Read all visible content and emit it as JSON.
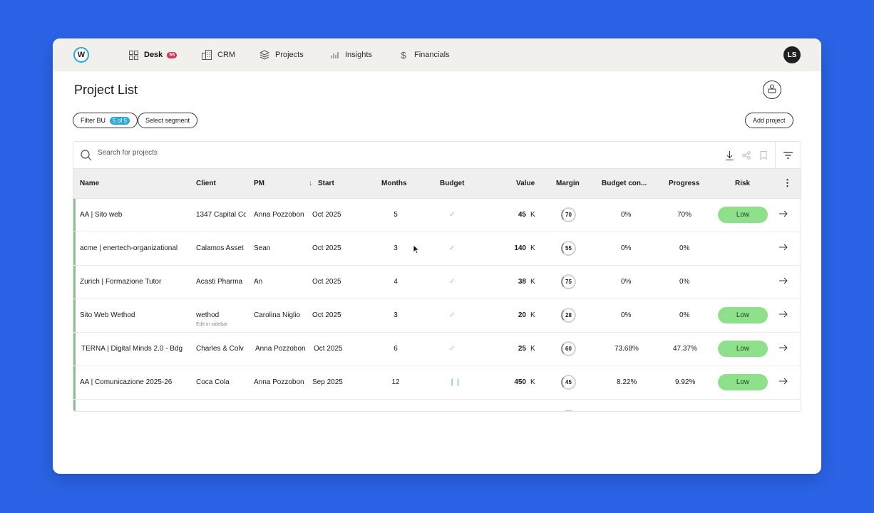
{
  "nav": {
    "logo": "W",
    "items": [
      {
        "label": "Desk",
        "badge": "55",
        "icon": "grid-icon"
      },
      {
        "label": "CRM",
        "icon": "building-icon"
      },
      {
        "label": "Projects",
        "icon": "layers-icon"
      },
      {
        "label": "Insights",
        "icon": "bar-chart-icon"
      },
      {
        "label": "Financials",
        "icon": "dollar-icon"
      }
    ],
    "avatar": "LS"
  },
  "page": {
    "title": "Project List",
    "filter_bu": "Filter BU",
    "filter_count": "5 of 5",
    "select_segment": "Select segment",
    "add_project": "Add project"
  },
  "search": {
    "placeholder": "Search for projects"
  },
  "columns": [
    "Name",
    "Client",
    "PM",
    "Start",
    "Months",
    "Budget",
    "Value",
    "Margin",
    "Budget con...",
    "Progress",
    "Risk"
  ],
  "rows": [
    {
      "name": "AA | Sito web",
      "client": "1347 Capital Co",
      "pm": "Anna Pozzobon",
      "start": "Oct 2025",
      "months": "5",
      "budget": "check",
      "value": "45",
      "unit": "K",
      "margin": "70",
      "budget_con": "0%",
      "progress": "70%",
      "risk": "Low"
    },
    {
      "name": "acme | enertech-organizational",
      "client": "Calamos Asset",
      "pm": "Sean",
      "start": "Oct 2025",
      "months": "3",
      "budget": "check",
      "value": "140",
      "unit": "K",
      "margin": "55",
      "budget_con": "0%",
      "progress": "0%",
      "risk": ""
    },
    {
      "name": "Zurich | Formazione Tutor",
      "client": "Acasti Pharma",
      "pm": "An",
      "start": "Oct 2025",
      "months": "4",
      "budget": "check",
      "value": "38",
      "unit": "K",
      "margin": "75",
      "budget_con": "0%",
      "progress": "0%",
      "risk": ""
    },
    {
      "name": "Sito Web Wethod",
      "client": "wethod",
      "client_note": "Edit in sidebar",
      "pm": "Carolina Niglio",
      "start": "Oct 2025",
      "months": "3",
      "budget": "check",
      "value": "20",
      "unit": "K",
      "margin": "28",
      "budget_con": "0%",
      "progress": "0%",
      "risk": "Low"
    },
    {
      "name": "TERNA | Digital Minds 2.0 - Bdg",
      "client": "Charles & Colv",
      "pm": "Anna Pozzobon",
      "start": "Oct 2025",
      "months": "6",
      "budget": "check",
      "value": "25",
      "unit": "K",
      "margin": "60",
      "budget_con": "73.68%",
      "progress": "47.37%",
      "risk": "Low"
    },
    {
      "name": "AA | Comunicazione 2025-26",
      "client": "Coca Cola",
      "pm": "Anna Pozzobon",
      "start": "Sep 2025",
      "months": "12",
      "budget": "pause",
      "value": "450",
      "unit": "K",
      "margin": "45",
      "budget_con": "8.22%",
      "progress": "9.92%",
      "risk": "Low"
    }
  ]
}
